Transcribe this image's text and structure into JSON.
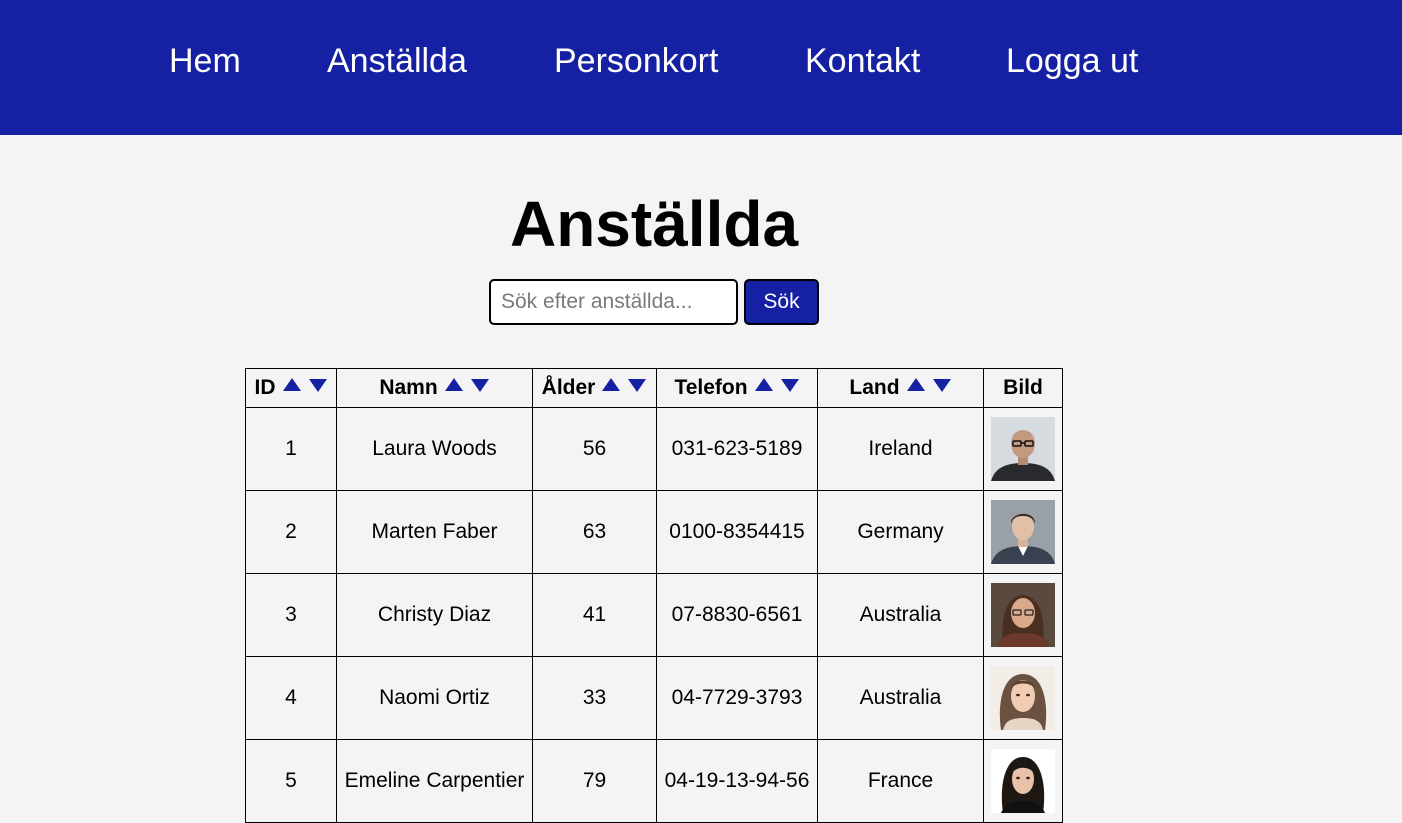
{
  "nav": {
    "items": [
      {
        "label": "Hem"
      },
      {
        "label": "Anställda"
      },
      {
        "label": "Personkort"
      },
      {
        "label": "Kontakt"
      },
      {
        "label": "Logga ut"
      }
    ]
  },
  "title": "Anställda",
  "search": {
    "placeholder": "Sök efter anställda...",
    "value": "",
    "button_label": "Sök"
  },
  "table": {
    "headers": [
      "ID",
      "Namn",
      "Ålder",
      "Telefon",
      "Land",
      "Bild"
    ],
    "rows": [
      {
        "id": "1",
        "name": "Laura Woods",
        "age": "56",
        "phone": "031-623-5189",
        "country": "Ireland",
        "photo": "woman-with-glasses-photo"
      },
      {
        "id": "2",
        "name": "Marten Faber",
        "age": "63",
        "phone": "0100-8354415",
        "country": "Germany",
        "photo": "man-in-suit-photo"
      },
      {
        "id": "3",
        "name": "Christy Diaz",
        "age": "41",
        "phone": "07-8830-6561",
        "country": "Australia",
        "photo": "woman-brown-hair-photo"
      },
      {
        "id": "4",
        "name": "Naomi Ortiz",
        "age": "33",
        "phone": "04-7729-3793",
        "country": "Australia",
        "photo": "woman-long-hair-photo"
      },
      {
        "id": "5",
        "name": "Emeline Carpentier",
        "age": "79",
        "phone": "04-19-13-94-56",
        "country": "France",
        "photo": "woman-dark-hair-photo"
      }
    ]
  },
  "colors": {
    "accent": "#1620a3",
    "background": "#f4f4f4",
    "sort_arrow": "#1620a3"
  },
  "icons": {
    "sort_asc": "triangle-up-icon",
    "sort_desc": "triangle-down-icon"
  }
}
